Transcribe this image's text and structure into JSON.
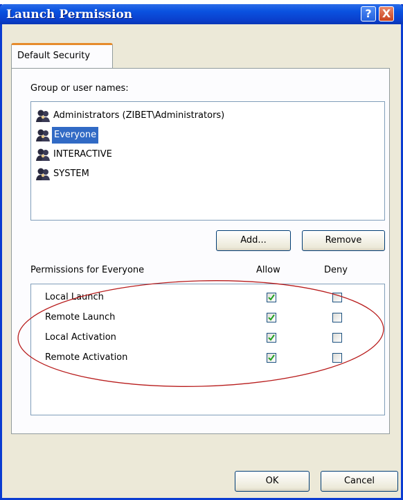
{
  "window": {
    "title": "Launch Permission",
    "help_symbol": "?",
    "close_symbol": "X",
    "title_gradient": "#0a52e0"
  },
  "tabs": [
    {
      "label": "Default Security",
      "active": true,
      "accent": "#e68b2c"
    }
  ],
  "groups": {
    "label": "Group or user names:",
    "items": [
      {
        "name": "Administrators (ZIBET\\Administrators)",
        "icon": "users-group-icon",
        "selected": false
      },
      {
        "name": "Everyone",
        "icon": "users-group-icon",
        "selected": true
      },
      {
        "name": "INTERACTIVE",
        "icon": "users-group-icon",
        "selected": false
      },
      {
        "name": "SYSTEM",
        "icon": "users-group-icon",
        "selected": false
      }
    ],
    "selection_color": "#316ac5"
  },
  "buttons": {
    "add": "Add...",
    "remove": "Remove",
    "ok": "OK",
    "cancel": "Cancel"
  },
  "permissions": {
    "label": "Permissions for Everyone",
    "allow_header": "Allow",
    "deny_header": "Deny",
    "rows": [
      {
        "name": "Local Launch",
        "allow": true,
        "deny": false
      },
      {
        "name": "Remote Launch",
        "allow": true,
        "deny": false
      },
      {
        "name": "Local Activation",
        "allow": true,
        "deny": false
      },
      {
        "name": "Remote Activation",
        "allow": true,
        "deny": false
      }
    ],
    "annotation_color": "#b81c1c",
    "check_color": "#21a121"
  }
}
